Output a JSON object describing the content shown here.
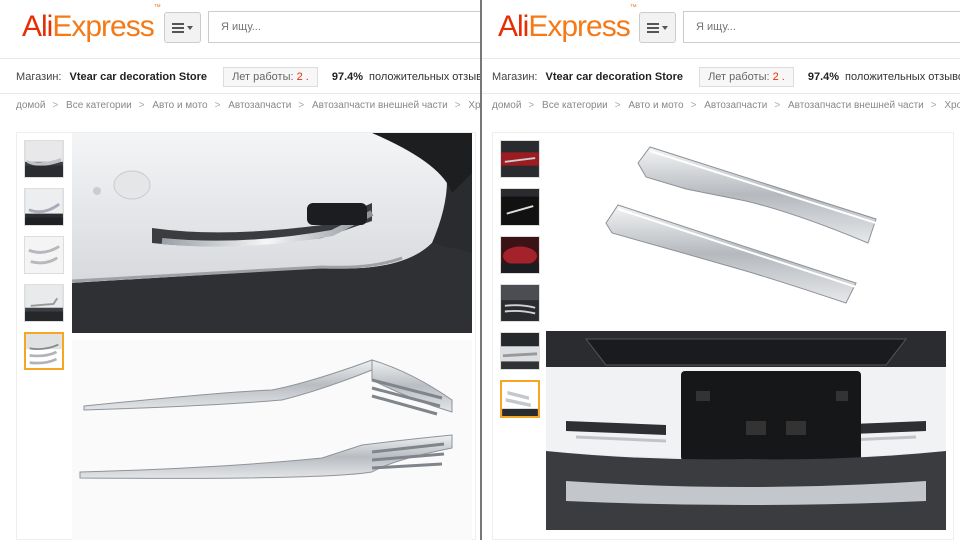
{
  "header": {
    "logo_ali": "Ali",
    "logo_express": "Express",
    "logo_tm": "™",
    "search_placeholder": "Я ищу..."
  },
  "store": {
    "label": "Магазин:",
    "name": "Vtear car decoration Store",
    "years_label": "Лет работы:",
    "years_value": "2 .",
    "positive_pct": "97.4%",
    "positive_label": "положительных отзывов"
  },
  "breadcrumb": [
    "домой",
    "Все категории",
    "Авто и мото",
    "Автозапчасти",
    "Автозапчасти внешней части",
    "Хромиров"
  ],
  "colors": {
    "accent": "#e62e04",
    "logo_orange": "#f57a17",
    "active_thumb": "#f5a623"
  },
  "left_pane": {
    "thumb_count": 5,
    "active_thumb_index": 4
  },
  "right_pane": {
    "thumb_count": 6,
    "active_thumb_index": 5
  }
}
